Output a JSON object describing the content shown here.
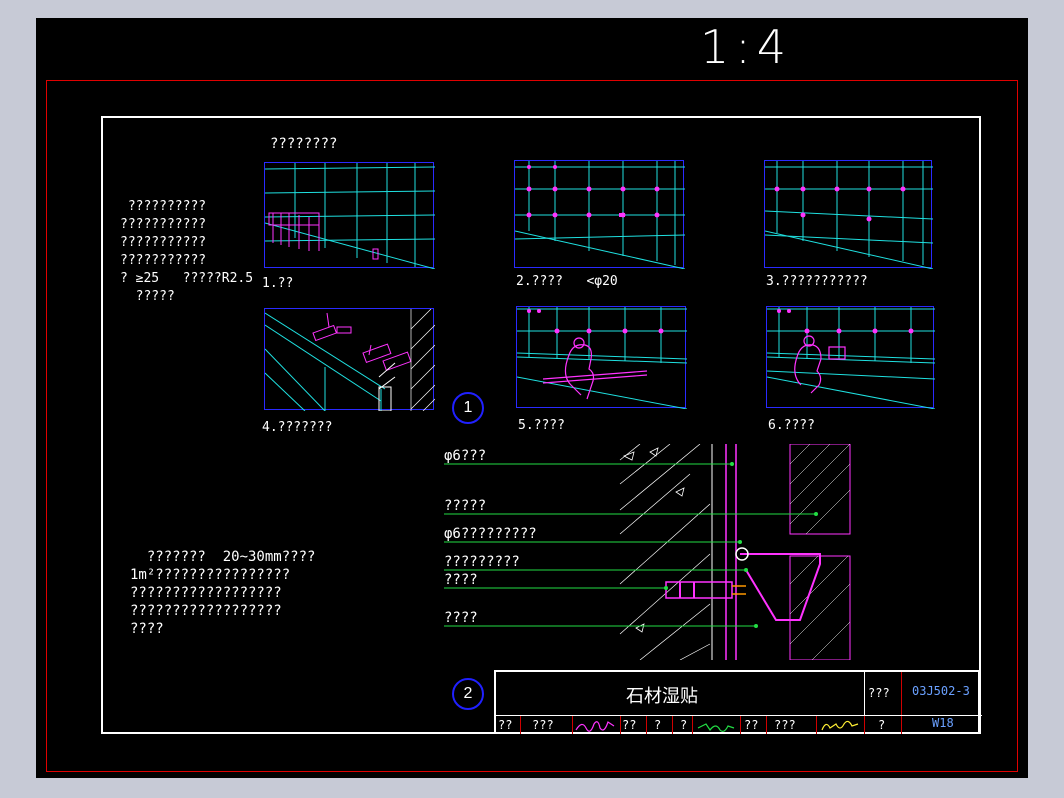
{
  "scale": "1:4",
  "figure1": {
    "marker": "1",
    "header": "????????",
    "note_lines": [
      " ??????????",
      "???????????",
      "???????????",
      "???????????",
      "? ≥25   ?????R2.5",
      "  ?????"
    ],
    "steps": [
      {
        "label": "1.??"
      },
      {
        "label": "2.????   <φ20"
      },
      {
        "label": "3.???????????"
      },
      {
        "label": "4.???????"
      },
      {
        "label": "5.????"
      },
      {
        "label": "6.????"
      }
    ]
  },
  "figure2": {
    "marker": "2",
    "note_lines": [
      "  ???????  20~30mm????",
      "1m²????????????????",
      "??????????????????",
      "??????????????????",
      "????"
    ],
    "callouts": [
      {
        "text": "φ6???"
      },
      {
        "text": "?????"
      },
      {
        "text": "φ6?????????"
      },
      {
        "text": "?????????"
      },
      {
        "text": "????"
      },
      {
        "text": "????"
      }
    ]
  },
  "title_block": {
    "drawing_title": "石材湿贴",
    "atlas_label": "???",
    "atlas_number": "03J502-3",
    "page_label": "?",
    "page_number": "W18",
    "row": [
      "??",
      "???",
      "??",
      "?",
      "?",
      "??",
      "???"
    ]
  },
  "colors": {
    "grid_cyan": "#1fe0e0",
    "frame_blue": "#2a2aff",
    "accent_magenta": "#ff33ff",
    "leader_green": "#22dd44",
    "border_red": "#e00000"
  }
}
